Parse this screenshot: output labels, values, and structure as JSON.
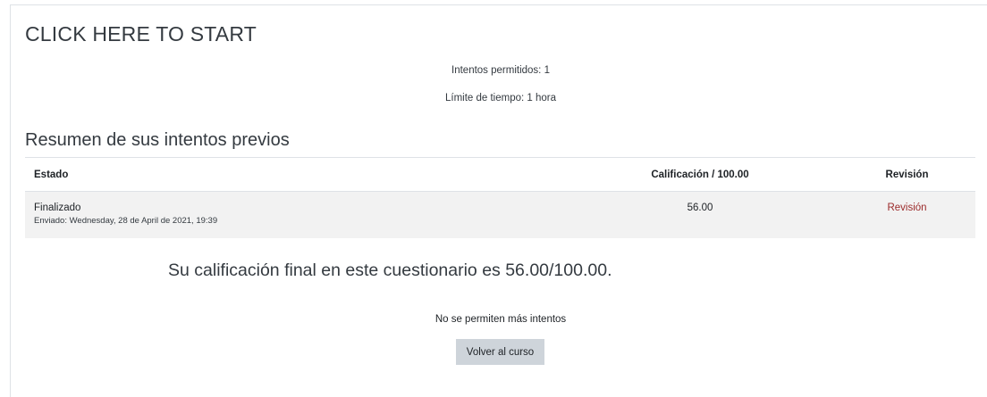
{
  "page": {
    "title": "CLICK HERE TO START"
  },
  "quiz_info": {
    "attempts_allowed": "Intentos permitidos: 1",
    "time_limit": "Límite de tiempo: 1 hora"
  },
  "summary": {
    "heading": "Resumen de sus intentos previos",
    "columns": {
      "state": "Estado",
      "grade": "Calificación / 100.00",
      "review": "Revisión"
    },
    "rows": [
      {
        "state": "Finalizado",
        "submitted": "Enviado: Wednesday, 28 de April de 2021, 19:39",
        "grade": "56.00",
        "review_link": "Revisión"
      }
    ]
  },
  "result": {
    "final_grade_text": "Su calificación final en este cuestionario es 56.00/100.00.",
    "no_more_attempts": "No se permiten más intentos",
    "back_button": "Volver al curso"
  },
  "colors": {
    "link": "#9b2a2a",
    "row_background": "#f2f2f2",
    "button_background": "#ced4da"
  }
}
